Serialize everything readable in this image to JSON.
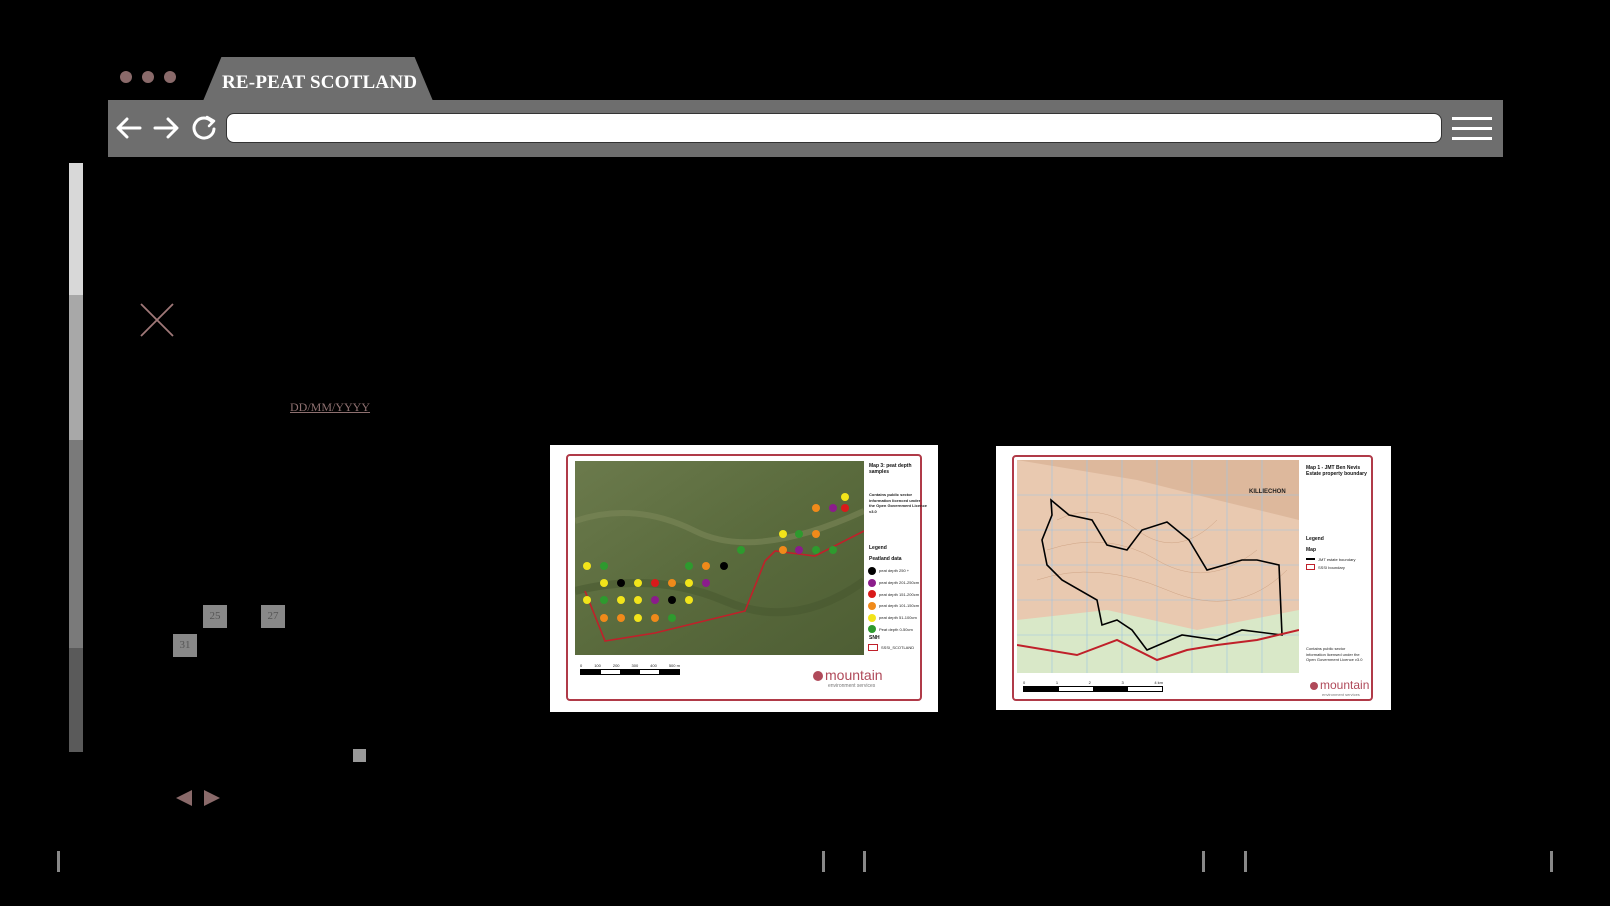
{
  "window": {
    "tab_title": "RE-PEAT SCOTLAND"
  },
  "icons": {
    "back": "arrow-left-icon",
    "forward": "arrow-right-icon",
    "reload": "reload-icon",
    "menu": "hamburger-menu-icon",
    "close": "close-icon",
    "prev": "triangle-left-icon",
    "next": "triangle-right-icon"
  },
  "colors": {
    "chrome": "#6e6e6e",
    "accent": "#8a6a6a",
    "map_border": "#b03a48"
  },
  "address_bar": {
    "value": ""
  },
  "form": {
    "date_placeholder": "DD/MM/YYYY"
  },
  "calendar": {
    "days": [
      "25",
      "27",
      "31"
    ]
  },
  "maps": [
    {
      "title": "Map 3: peat depth samples",
      "licence": "Contains public sector information licenced under the Open Government Licence v3.0",
      "legend_heading": "Legend",
      "legend_sub": "Peatland data",
      "legend_items": [
        {
          "label": "peat depth 250 +",
          "color": "#000000"
        },
        {
          "label": "peat depth 201-250cm",
          "color": "#8b1c8b"
        },
        {
          "label": "peat depth 151-200cm",
          "color": "#d91a1a"
        },
        {
          "label": "peat depth 101-150cm",
          "color": "#f08a1a"
        },
        {
          "label": "peat depth 51-100cm",
          "color": "#f2e41a"
        },
        {
          "label": "Peat depth 0-50cm",
          "color": "#2e9a2e"
        }
      ],
      "legend_sub2": "SNH",
      "boundary_label": "SSSI_SCOTLAND",
      "scale_ticks": [
        "0",
        "100",
        "200",
        "300",
        "400",
        "500 m"
      ],
      "logo": "mountain",
      "logo_sub": "environment services"
    },
    {
      "title": "Map 1 - JMT Ben Nevis Estate property boundary",
      "place_label": "KILLIECHON",
      "legend_heading": "Legend",
      "legend_sub": "Map",
      "legend_items": [
        {
          "label": "JMT estate boundary",
          "color": "#000000"
        },
        {
          "label": "SSSI boundary",
          "color": "#c0202a"
        }
      ],
      "licence": "Contains public sector information licensed under the Open Government Licence v3.0",
      "scale_ticks": [
        "0",
        "1",
        "2",
        "3",
        "4 km"
      ],
      "logo": "mountain",
      "logo_sub": "environment services"
    }
  ]
}
